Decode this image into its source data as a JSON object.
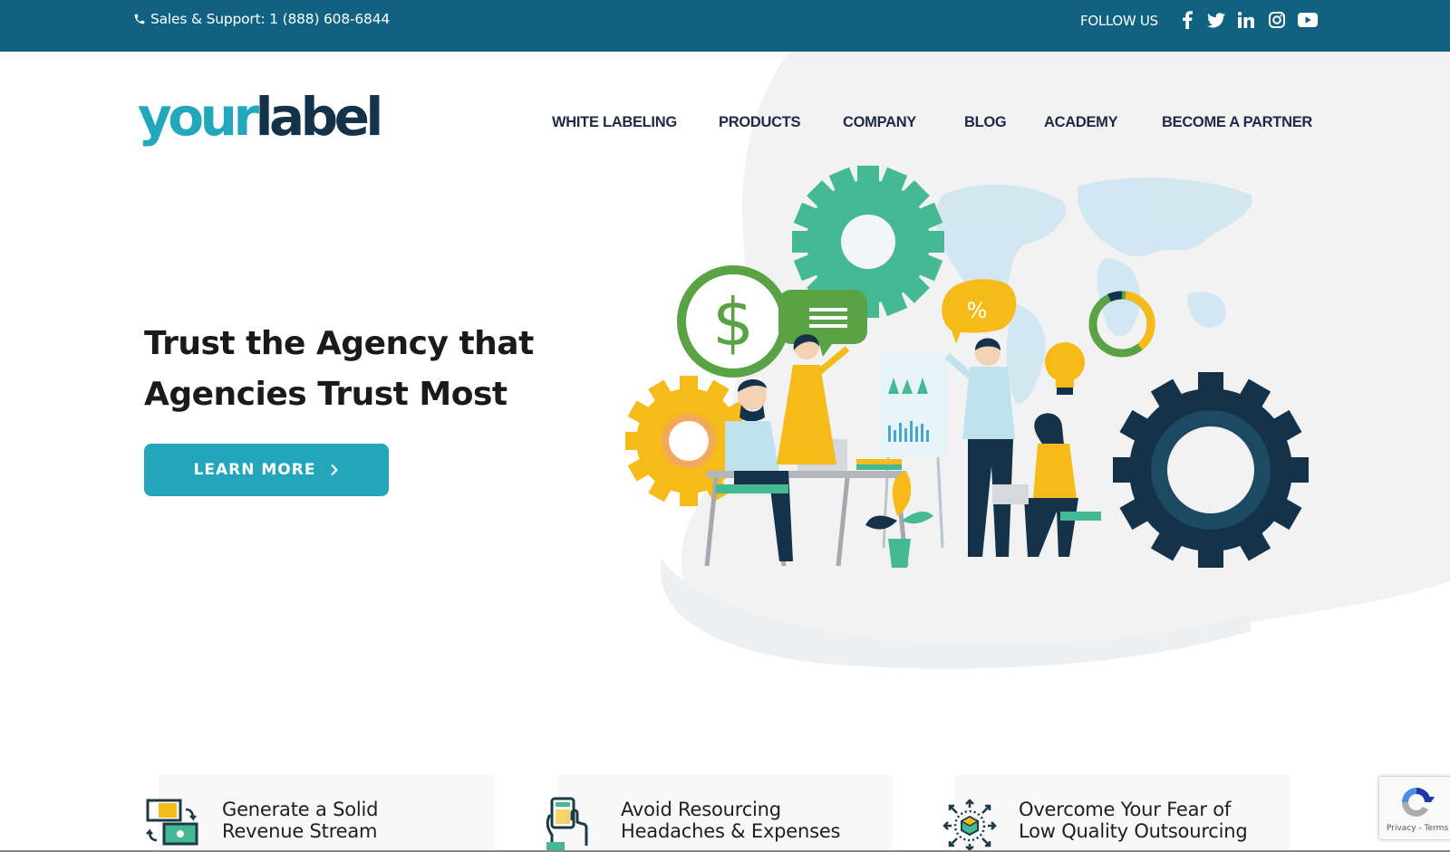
{
  "topbar": {
    "phone_label": "Sales & Support: 1 (888) 608-6844",
    "follow_label": "FOLLOW US",
    "social": [
      {
        "name": "facebook-icon"
      },
      {
        "name": "twitter-icon"
      },
      {
        "name": "linkedin-icon"
      },
      {
        "name": "instagram-icon"
      },
      {
        "name": "youtube-icon"
      }
    ]
  },
  "logo": {
    "part1": "your",
    "part2": "label"
  },
  "nav": {
    "items": [
      {
        "label": "WHITE LABELING"
      },
      {
        "label": "PRODUCTS"
      },
      {
        "label": "COMPANY"
      },
      {
        "label": "BLOG"
      },
      {
        "label": "ACADEMY"
      },
      {
        "label": "BECOME A PARTNER"
      }
    ]
  },
  "hero": {
    "title_line1": "Trust the Agency that",
    "title_line2": "Agencies Trust Most",
    "cta_label": "LEARN MORE",
    "illustration": "team-collaboration-illustration"
  },
  "features": [
    {
      "line1": "Generate a Solid",
      "line2": "Revenue Stream",
      "icon": "money-exchange-icon"
    },
    {
      "line1": "Avoid Resourcing",
      "line2": "Headaches & Expenses",
      "icon": "calculator-hand-icon"
    },
    {
      "line1": "Overcome Your Fear of",
      "line2": "Low Quality Outsourcing",
      "icon": "box-expand-icon"
    }
  ],
  "recaptcha": {
    "links": "Privacy - Terms"
  },
  "colors": {
    "topbar": "#116282",
    "brand_teal": "#22a8bd",
    "brand_navy": "#14334a",
    "cta": "#23a6bb"
  }
}
